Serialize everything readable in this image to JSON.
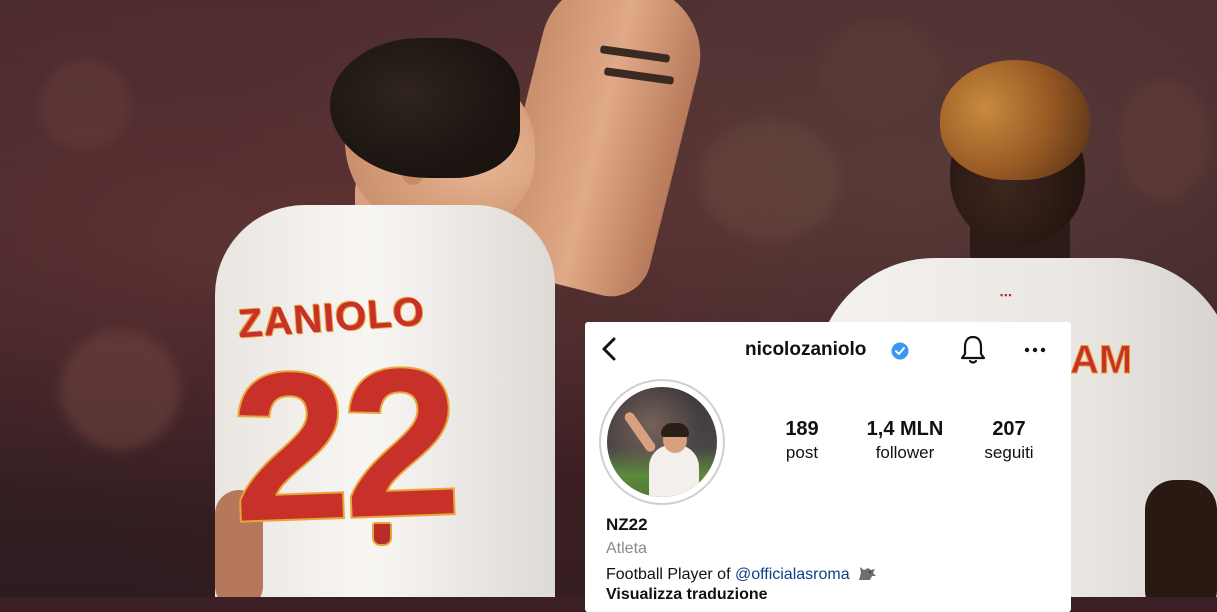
{
  "photo": {
    "left_player": {
      "jersey_name": "ZANIOLO",
      "jersey_number": "22"
    },
    "right_player": {
      "jersey_name_partial": "AM"
    }
  },
  "instagram": {
    "username": "nicolozaniolo",
    "verified": true,
    "icons": [
      "back-icon",
      "verified-icon",
      "bell-icon",
      "more-icon"
    ],
    "stats": [
      {
        "value": "189",
        "label": "post"
      },
      {
        "value": "1,4 MLN",
        "label": "follower"
      },
      {
        "value": "207",
        "label": "seguiti"
      }
    ],
    "bio": {
      "name": "NZ22",
      "category": "Atleta",
      "text_prefix": "Football Player of ",
      "mention": "@officialasroma",
      "emoji": "wolf-icon",
      "translate": "Visualizza traduzione"
    }
  },
  "colors": {
    "roma_red": "#c8302a",
    "roma_gold": "#e8a63a",
    "link_blue": "#0d3f8a",
    "verified_blue": "#3897f0"
  }
}
